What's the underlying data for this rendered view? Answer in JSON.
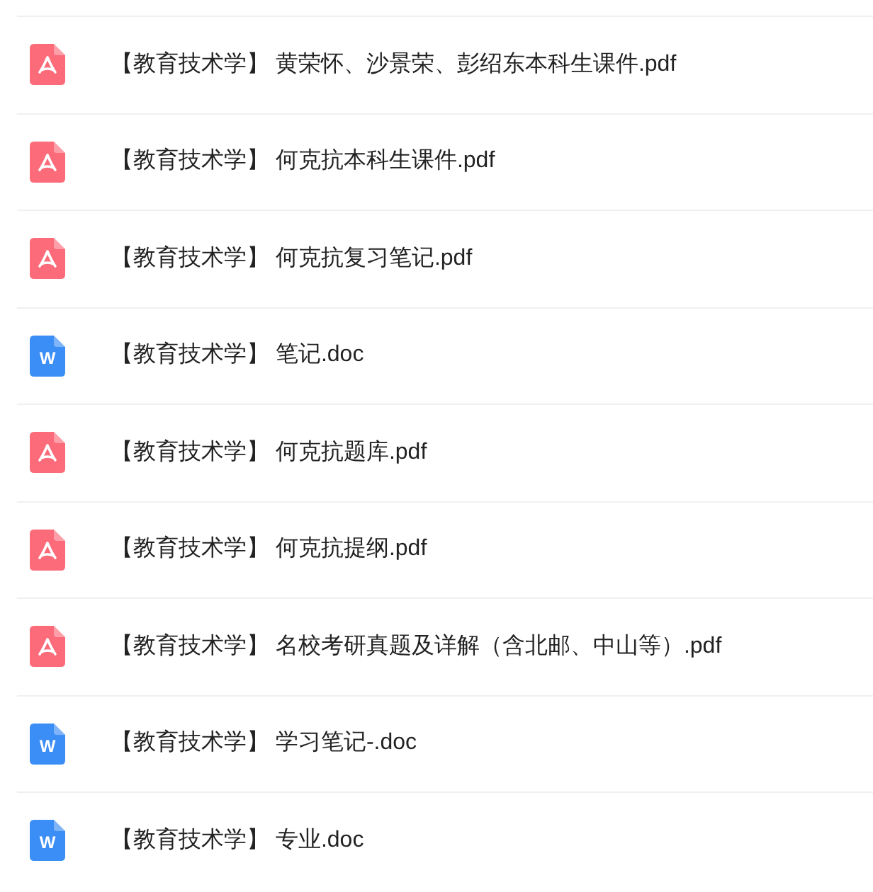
{
  "files": [
    {
      "kind": "pdf",
      "title": "【教育技术学】 黄荣怀、沙景荣、彭绍东本科生课件.pdf"
    },
    {
      "kind": "pdf",
      "title": "【教育技术学】 何克抗本科生课件.pdf"
    },
    {
      "kind": "pdf",
      "title": "【教育技术学】 何克抗复习笔记.pdf"
    },
    {
      "kind": "doc",
      "icon_letter": "W",
      "title": "【教育技术学】 笔记.doc"
    },
    {
      "kind": "pdf",
      "title": "【教育技术学】 何克抗题库.pdf"
    },
    {
      "kind": "pdf",
      "title": "【教育技术学】 何克抗提纲.pdf"
    },
    {
      "kind": "pdf",
      "title": "【教育技术学】 名校考研真题及详解（含北邮、中山等）.pdf"
    },
    {
      "kind": "doc",
      "icon_letter": "W",
      "title": "【教育技术学】 学习笔记-.doc"
    },
    {
      "kind": "doc",
      "icon_letter": "W",
      "title": "【教育技术学】 专业.doc"
    }
  ]
}
